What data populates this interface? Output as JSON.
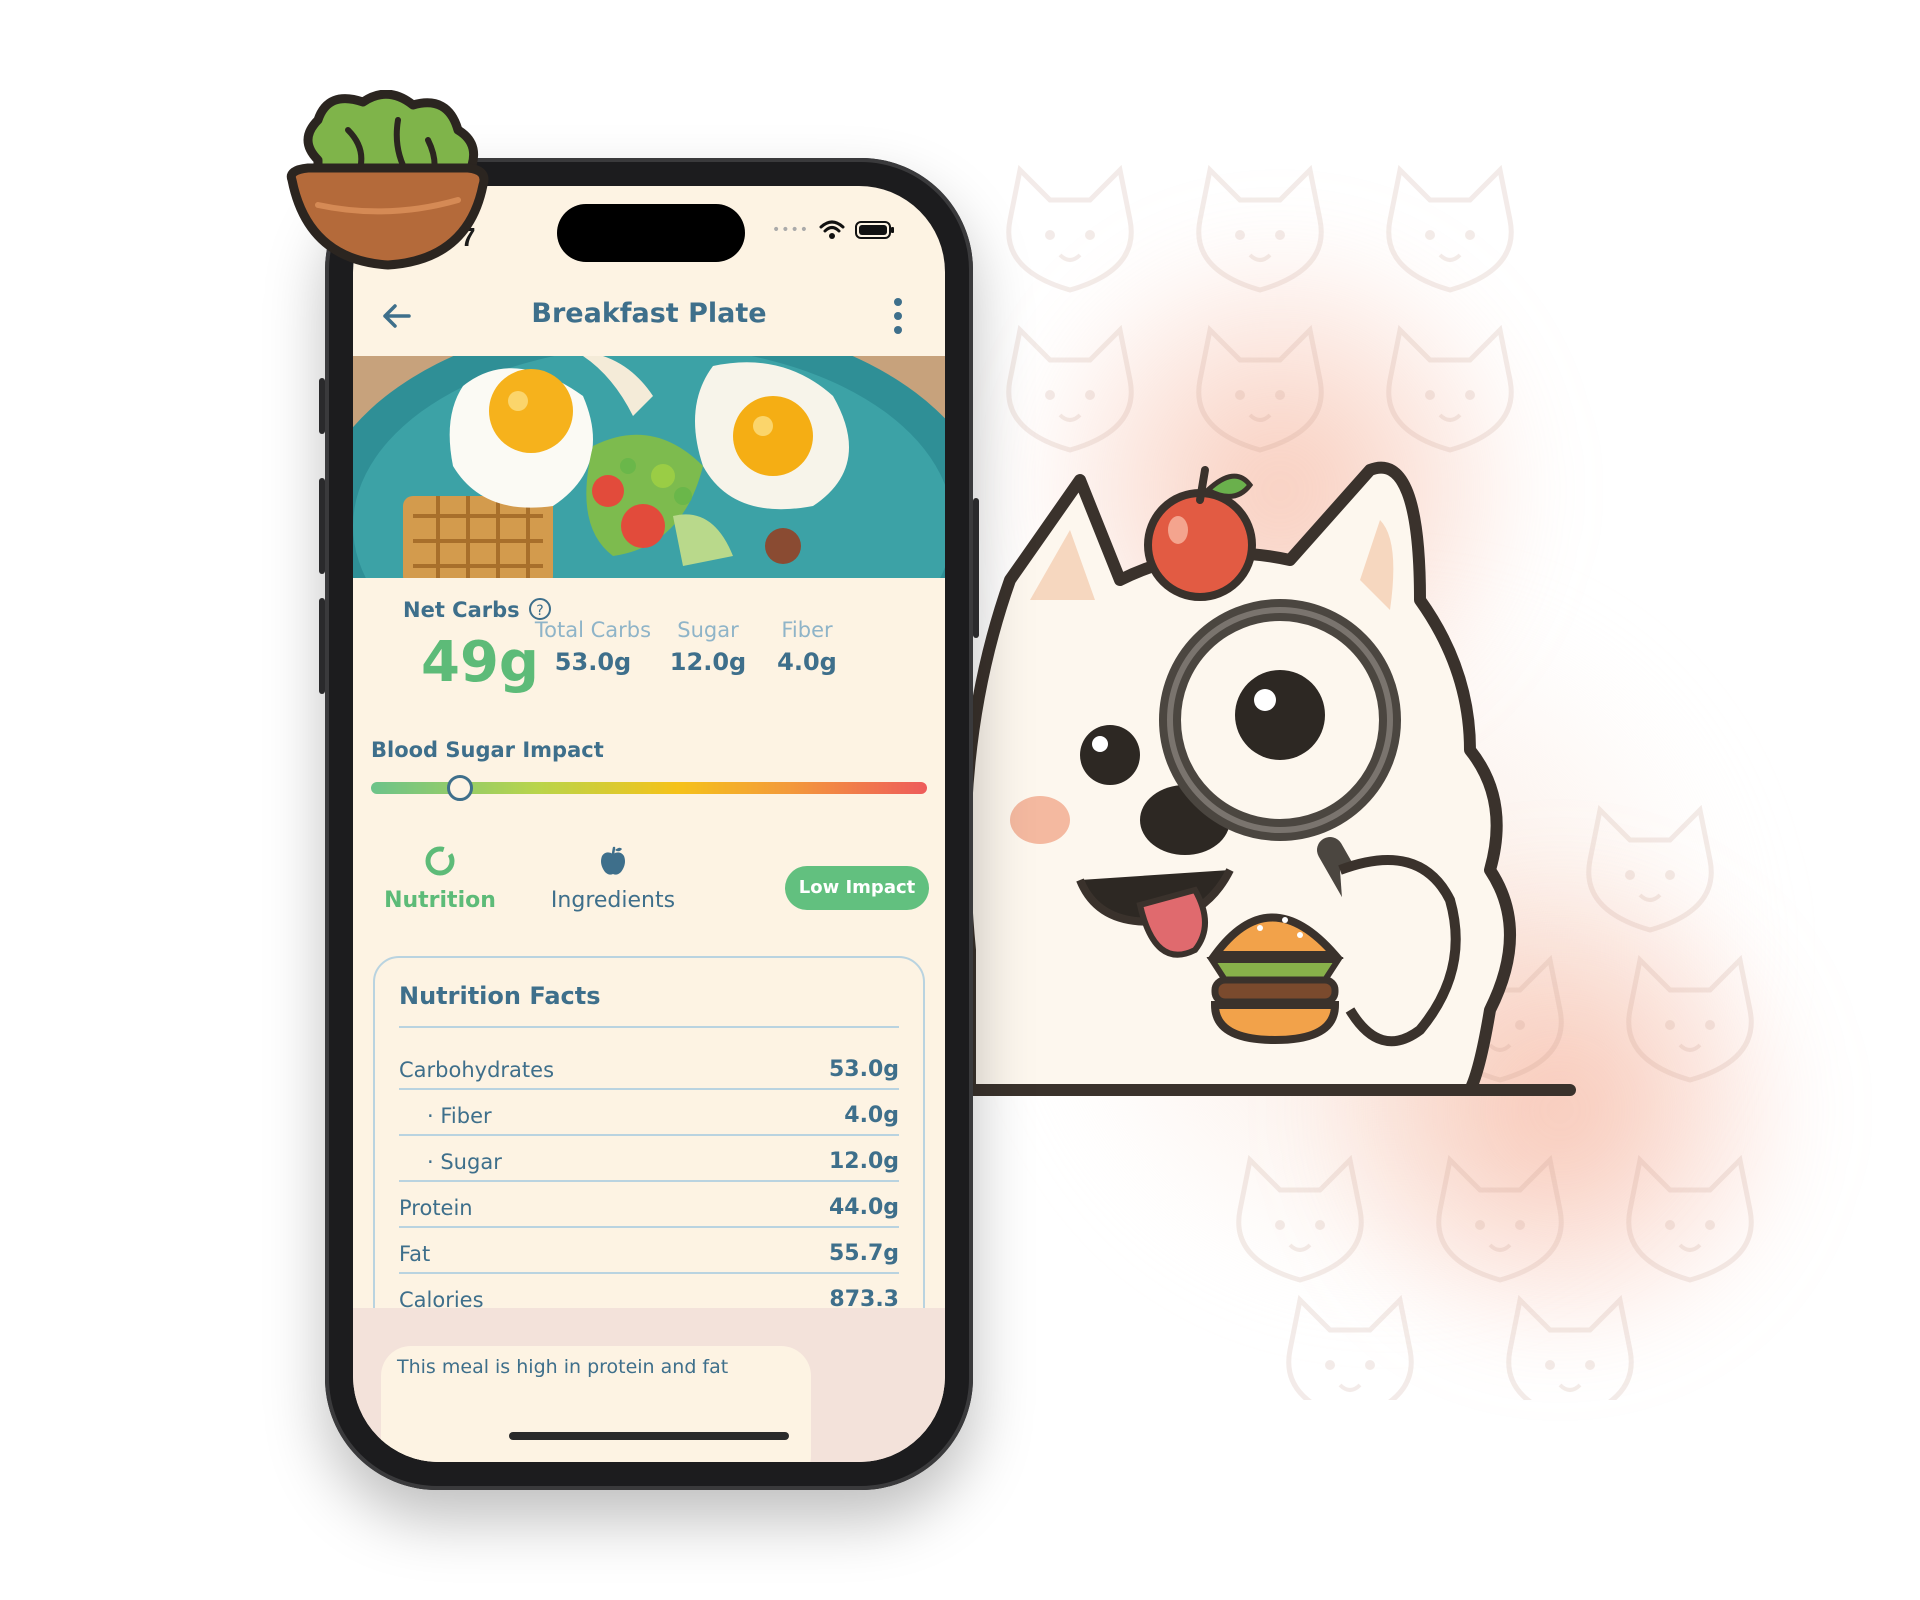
{
  "colors": {
    "primary": "#3e6f8b",
    "accent_green": "#5dbb78",
    "muted_label": "#8fb4c8",
    "screen_bg": "#fdf3e3",
    "impact_gradient": [
      "#6cc38a",
      "#b9d44b",
      "#f5c21a",
      "#f39a3b",
      "#ee5b5b"
    ]
  },
  "status_bar": {
    "time_fragment": "7",
    "icons": [
      "signal-icon",
      "wifi-icon",
      "battery-icon"
    ]
  },
  "header": {
    "title": "Breakfast Plate",
    "back_icon": "back-arrow-icon",
    "menu_icon": "more-vertical-icon"
  },
  "photo": {
    "description_icon": "food-photo"
  },
  "net_carbs": {
    "label": "Net Carbs",
    "help_icon": "?",
    "value": "49g"
  },
  "stats": [
    {
      "label": "Total Carbs",
      "value": "53.0g"
    },
    {
      "label": "Sugar",
      "value": "12.0g"
    },
    {
      "label": "Fiber",
      "value": "4.0g"
    }
  ],
  "blood_sugar": {
    "label": "Blood Sugar Impact",
    "level_fraction": 0.16
  },
  "tabs": [
    {
      "label": "Nutrition",
      "icon": "ring-chart-icon",
      "active": true
    },
    {
      "label": "Ingredients",
      "icon": "apple-icon",
      "active": false
    }
  ],
  "impact_badge": "Low Impact",
  "nutrition_facts": {
    "title": "Nutrition Facts",
    "rows": [
      {
        "name": "Carbohydrates",
        "value": "53.0g",
        "sub": false
      },
      {
        "name": "· Fiber",
        "value": "4.0g",
        "sub": true
      },
      {
        "name": "· Sugar",
        "value": "12.0g",
        "sub": true
      },
      {
        "name": "Protein",
        "value": "44.0g",
        "sub": false
      },
      {
        "name": "Fat",
        "value": "55.7g",
        "sub": false
      },
      {
        "name": "Calories",
        "value": "873.3",
        "sub": false
      }
    ]
  },
  "summary": {
    "text": "This meal is high in protein and fat"
  }
}
